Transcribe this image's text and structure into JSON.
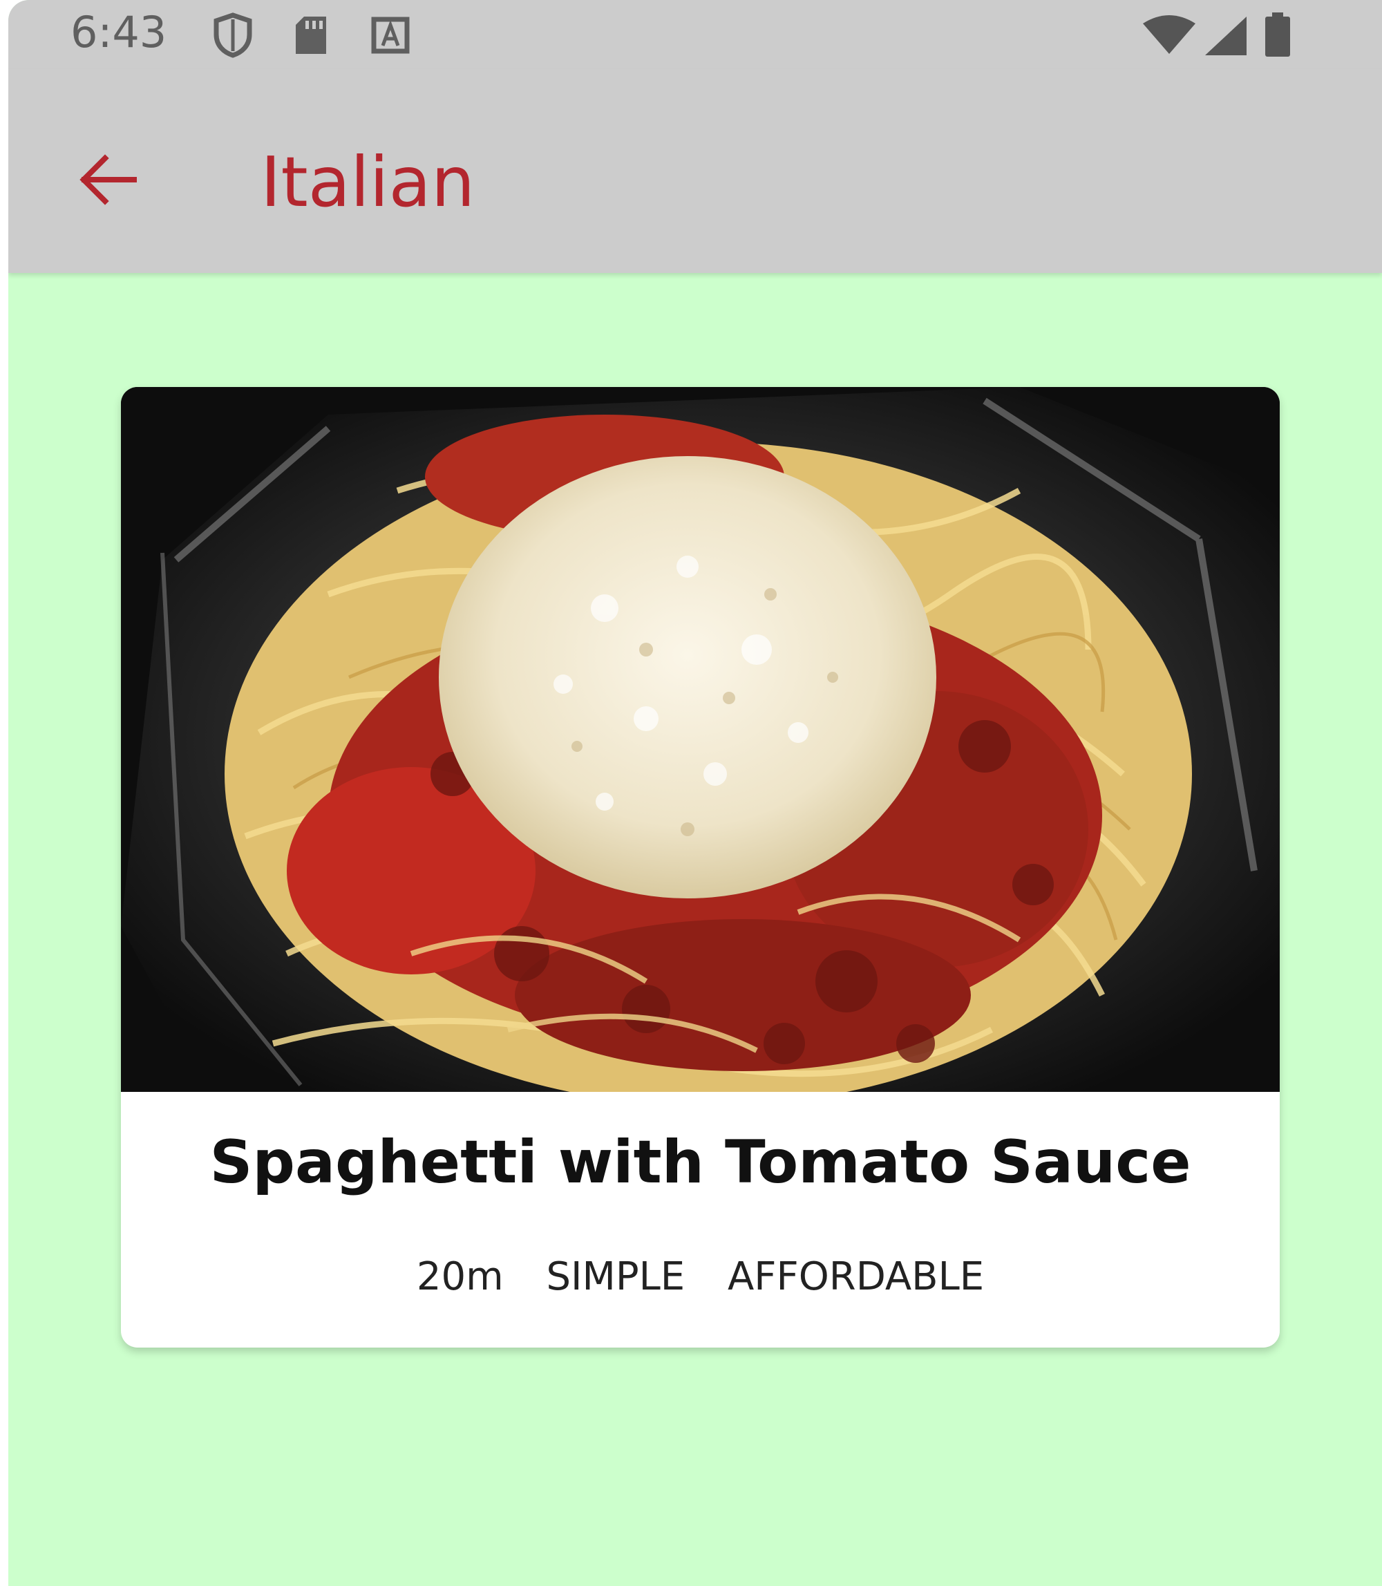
{
  "status_bar": {
    "time": "6:43",
    "left_icons": [
      "shield-icon",
      "sd-card-icon",
      "a-box-icon"
    ],
    "right_icons": [
      "wifi-icon",
      "signal-icon",
      "battery-icon"
    ]
  },
  "app_bar": {
    "back_icon": "arrow-left-icon",
    "title": "Italian"
  },
  "recipe": {
    "image_description": "spaghetti-photo",
    "title": "Spaghetti with Tomato Sauce",
    "duration": "20m",
    "complexity": "SIMPLE",
    "affordability": "AFFORDABLE"
  },
  "colors": {
    "accent": "#b3262e",
    "background": "#ccffcc",
    "app_bar": "#cccccc",
    "card": "#ffffff"
  }
}
